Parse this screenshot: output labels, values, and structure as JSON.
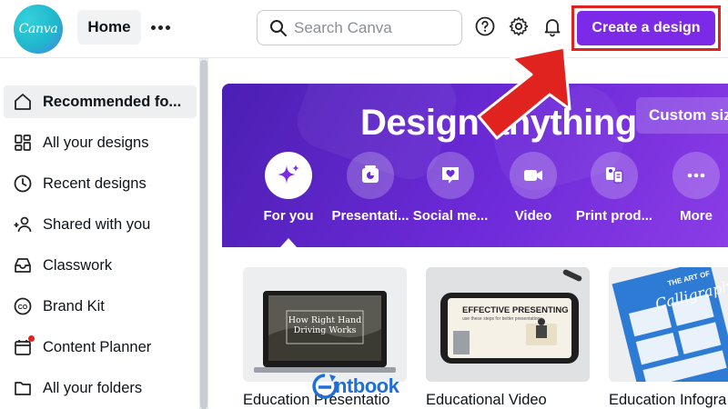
{
  "topbar": {
    "logo_text": "Canva",
    "home_label": "Home",
    "search_placeholder": "Search Canva",
    "create_label": "Create a design",
    "icons": [
      "help-icon",
      "gear-icon",
      "bell-icon"
    ]
  },
  "sidebar": {
    "items": [
      {
        "label": "Recommended fo...",
        "icon": "home-icon",
        "active": true
      },
      {
        "label": "All your designs",
        "icon": "grid-icon"
      },
      {
        "label": "Recent designs",
        "icon": "clock-icon"
      },
      {
        "label": "Shared with you",
        "icon": "people-icon"
      },
      {
        "label": "Classwork",
        "icon": "tray-icon"
      },
      {
        "label": "Brand Kit",
        "icon": "brand-icon"
      },
      {
        "label": "Content Planner",
        "icon": "calendar-icon"
      },
      {
        "label": "All your folders",
        "icon": "folder-icon"
      }
    ]
  },
  "hero": {
    "title": "Design anything",
    "custom_size_label": "Custom siz",
    "categories": [
      {
        "label": "For you",
        "icon": "sparkle-icon"
      },
      {
        "label": "Presentati...",
        "icon": "presentation-icon"
      },
      {
        "label": "Social me...",
        "icon": "heart-chat-icon"
      },
      {
        "label": "Video",
        "icon": "video-camera-icon"
      },
      {
        "label": "Print prod...",
        "icon": "print-icon"
      },
      {
        "label": "More",
        "icon": "more-dots-icon"
      }
    ]
  },
  "cards": [
    {
      "title": "Education Presentatio",
      "thumb_heading": "How Right Hand Driving Works"
    },
    {
      "title": "Educational Video",
      "thumb_heading": "EFFECTIVE PRESENTING",
      "thumb_sub": "use these steps for better presentations"
    },
    {
      "title": "Education Infogra",
      "thumb_heading": "THE ART OF",
      "thumb_script": "Calligraphy"
    }
  ],
  "watermark": {
    "text": "ntbook"
  },
  "colors": {
    "brand_purple": "#7d2ae8",
    "annotation_red": "#e0231f",
    "logo_teal": "#1fb8cd"
  }
}
